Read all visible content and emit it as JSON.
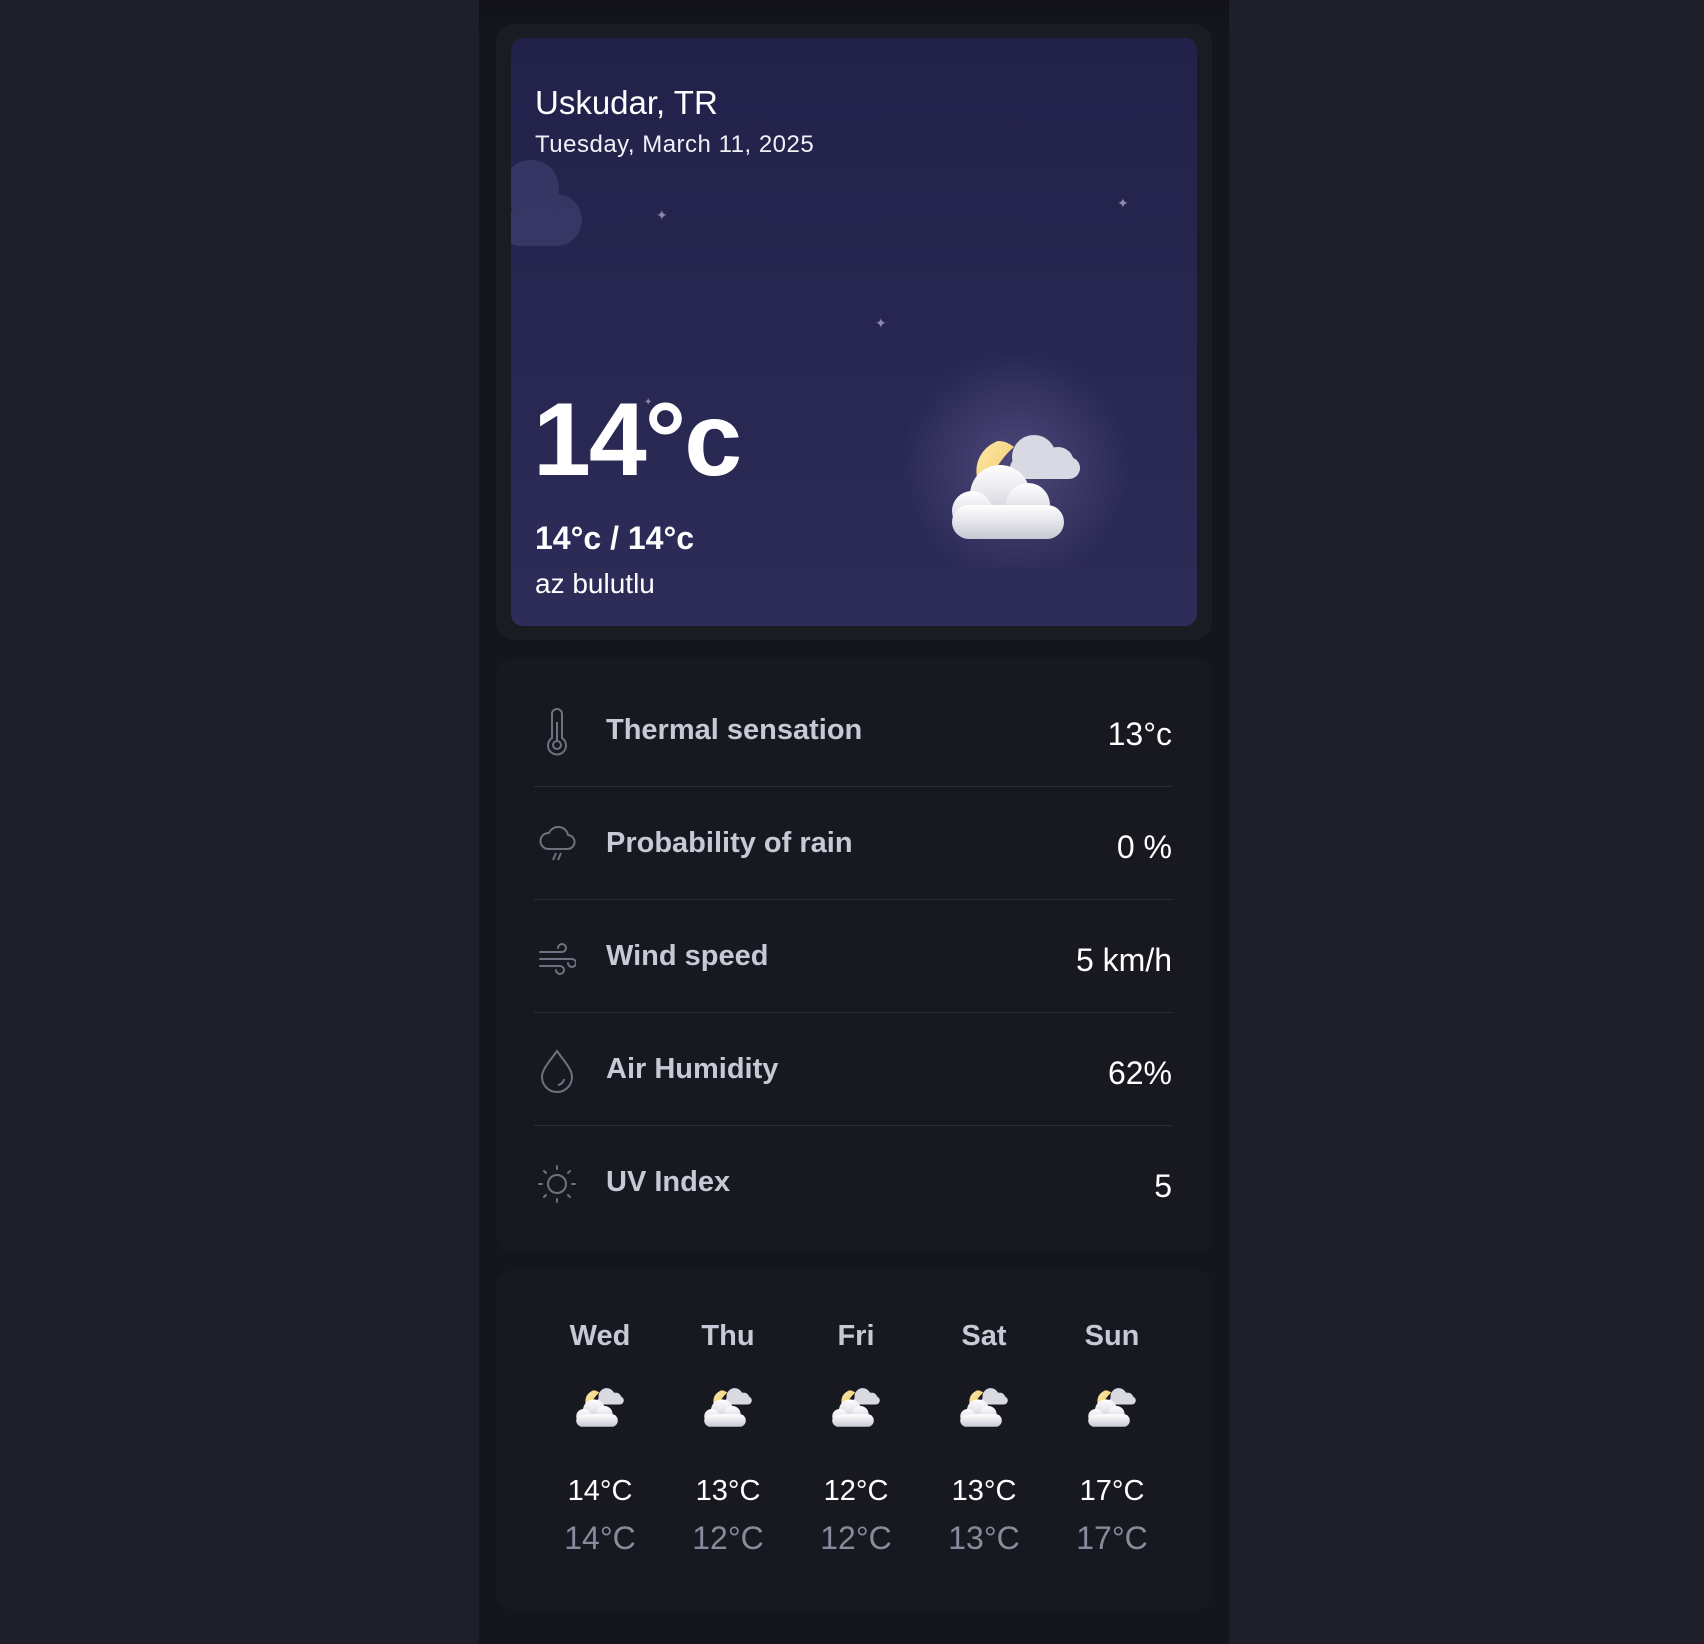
{
  "location": "Uskudar, TR",
  "date": "Tuesday, March 11, 2025",
  "current": {
    "temperature": "14°c",
    "min_max": "14°c / 14°c",
    "description": "az bulutlu",
    "icon": "partly-cloudy-night-icon"
  },
  "details": [
    {
      "icon": "thermometer-icon",
      "label": "Thermal sensation",
      "value": "13°c"
    },
    {
      "icon": "rain-cloud-icon",
      "label": "Probability of rain",
      "value": "0 %"
    },
    {
      "icon": "wind-icon",
      "label": "Wind speed",
      "value": "5 km/h"
    },
    {
      "icon": "droplet-icon",
      "label": "Air Humidity",
      "value": "62%"
    },
    {
      "icon": "sun-icon",
      "label": "UV Index",
      "value": "5"
    }
  ],
  "forecast": [
    {
      "day": "Wed",
      "max": "14°C",
      "min": "14°C",
      "icon": "partly-cloudy-icon"
    },
    {
      "day": "Thu",
      "max": "13°C",
      "min": "12°C",
      "icon": "partly-cloudy-icon"
    },
    {
      "day": "Fri",
      "max": "12°C",
      "min": "12°C",
      "icon": "partly-cloudy-icon"
    },
    {
      "day": "Sat",
      "max": "13°C",
      "min": "13°C",
      "icon": "partly-cloudy-icon"
    },
    {
      "day": "Sun",
      "max": "17°C",
      "min": "17°C",
      "icon": "partly-cloudy-icon"
    }
  ],
  "colors": {
    "background": "#1f1f2a",
    "card": "#181920",
    "hero_top": "#22214a",
    "hero_bottom": "#2e2c58",
    "muted_text": "#8a8a9c"
  }
}
